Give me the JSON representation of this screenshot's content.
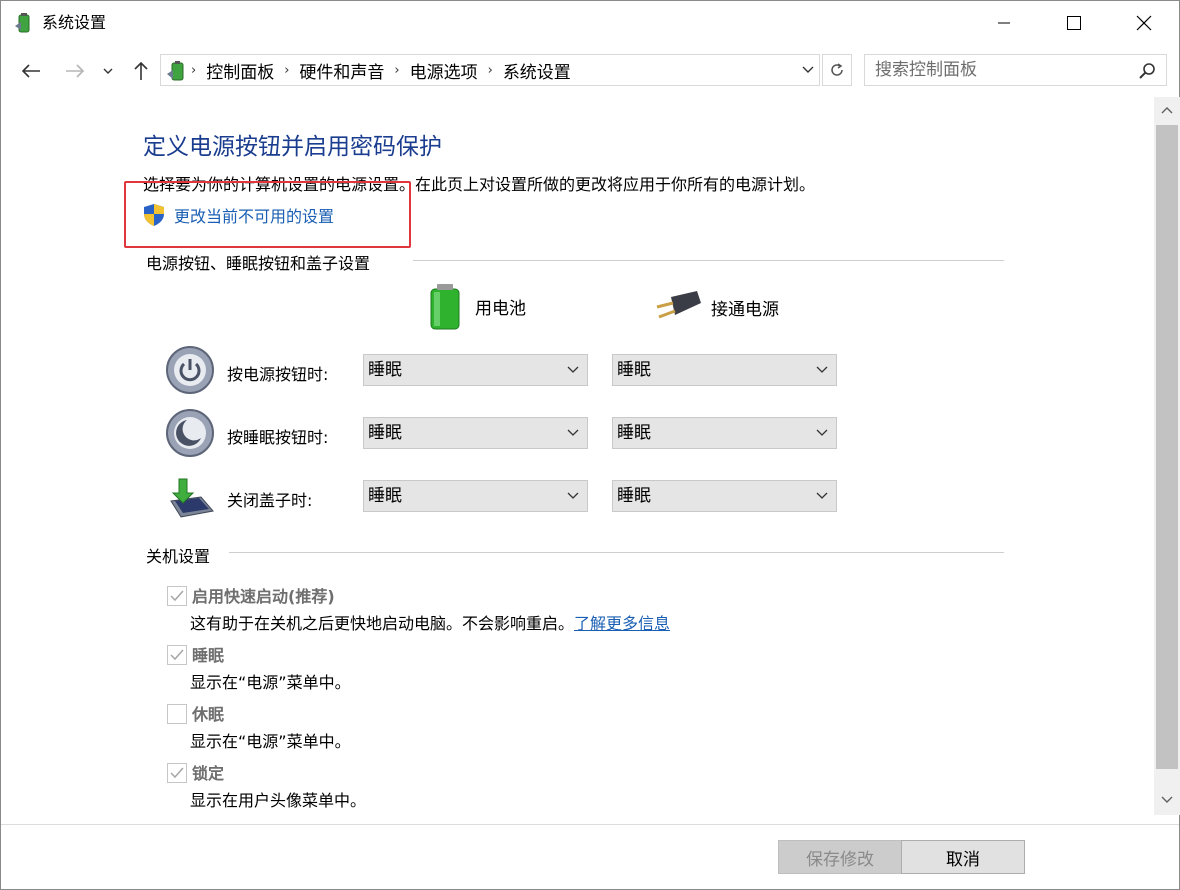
{
  "window": {
    "title": "系统设置"
  },
  "nav": {
    "breadcrumbs": [
      "控制面板",
      "硬件和声音",
      "电源选项",
      "系统设置"
    ],
    "search_placeholder": "搜索控制面板"
  },
  "page": {
    "title": "定义电源按钮并启用密码保护",
    "description": "选择要为你的计算机设置的电源设置。在此页上对设置所做的更改将应用于你所有的电源计划。",
    "change_link": "更改当前不可用的设置"
  },
  "power_section": {
    "heading": "电源按钮、睡眠按钮和盖子设置",
    "col_battery": "用电池",
    "col_plugged": "接通电源",
    "rows": [
      {
        "label": "按电源按钮时:",
        "battery": "睡眠",
        "plugged": "睡眠"
      },
      {
        "label": "按睡眠按钮时:",
        "battery": "睡眠",
        "plugged": "睡眠"
      },
      {
        "label": "关闭盖子时:",
        "battery": "睡眠",
        "plugged": "睡眠"
      }
    ]
  },
  "shutdown_section": {
    "heading": "关机设置",
    "options": [
      {
        "label": "启用快速启动(推荐)",
        "desc": "这有助于在关机之后更快地启动电脑。不会影响重启。",
        "link": "了解更多信息",
        "checked": true
      },
      {
        "label": "睡眠",
        "desc": "显示在“电源”菜单中。",
        "checked": true
      },
      {
        "label": "休眠",
        "desc": "显示在“电源”菜单中。",
        "checked": false
      },
      {
        "label": "锁定",
        "desc": "显示在用户头像菜单中。",
        "checked": true
      }
    ]
  },
  "footer": {
    "save": "保存修改",
    "cancel": "取消"
  },
  "colors": {
    "title_blue": "#1a3d8f",
    "link_blue": "#1a5fb4",
    "highlight_red": "#e0363d"
  }
}
